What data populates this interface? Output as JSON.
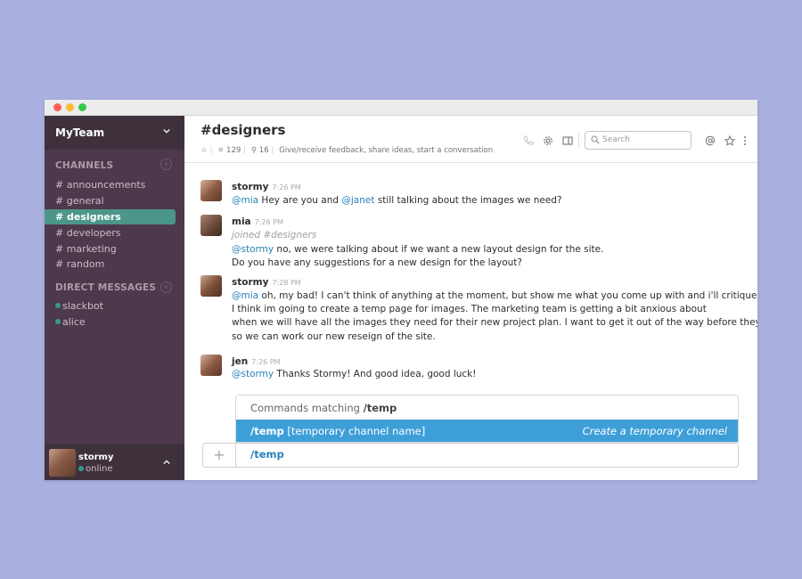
{
  "sidebar": {
    "team_name": "MyTeam",
    "channels_heading": "CHANNELS",
    "channels": [
      "announcements",
      "general",
      "designers",
      "developers",
      "marketing",
      "random"
    ],
    "active_channel": "designers",
    "dm_heading": "DIRECT MESSAGES",
    "direct_messages": [
      "slackbot",
      "alice"
    ],
    "user": {
      "name": "stormy",
      "status": "online"
    }
  },
  "header": {
    "channel": "#designers",
    "members": "129",
    "pins": "16",
    "topic": "Give/receive feedback, share ideas, start a conversation",
    "search_placeholder": "Search"
  },
  "messages": [
    {
      "user": "stormy",
      "time": "7:26 PM",
      "lines": [
        {
          "mention1": "@mia",
          "t1": " Hey are you and ",
          "mention2": "@janet",
          "t2": " still talking about the images we need?"
        }
      ]
    },
    {
      "user": "mia",
      "time": "7:26 PM",
      "system": "joined #designers",
      "line1_mention": "@stormy",
      "line1_text": " no, we were talking about if we want a new layout design for the site.",
      "line2": "Do you have any suggestions for a new design for the layout?"
    },
    {
      "user": "stormy",
      "time": "7:28 PM",
      "line1_mention": "@mia",
      "line1_text": " oh, my bad! I can't think of anything at the moment, but show me what you come up with and i'll critique it 👍🏼",
      "line2": " I think im going to create a temp page for images. The marketing team is getting a bit anxious about",
      "line3": " when we will have all the images they need for their new project plan. I want to get it out of the way before they get",
      "line4": " so we can work our new reseign of the site."
    },
    {
      "user": "jen",
      "time": "7:26 PM",
      "line1_mention": "@stormy",
      "line1_text": " Thanks Stormy! And good idea, good luck!"
    }
  ],
  "suggestions": {
    "heading_prefix": "Commands matching ",
    "heading_cmd": "/temp",
    "item_cmd": "/temp",
    "item_arg": " [temporary channel name]",
    "item_desc": "Create a temporary channel"
  },
  "composer": {
    "value": "/temp"
  },
  "colors": {
    "sidebar": "#4d394b",
    "active": "#4c9689",
    "mention": "#2a80b9",
    "highlight": "#3e9fd8"
  }
}
